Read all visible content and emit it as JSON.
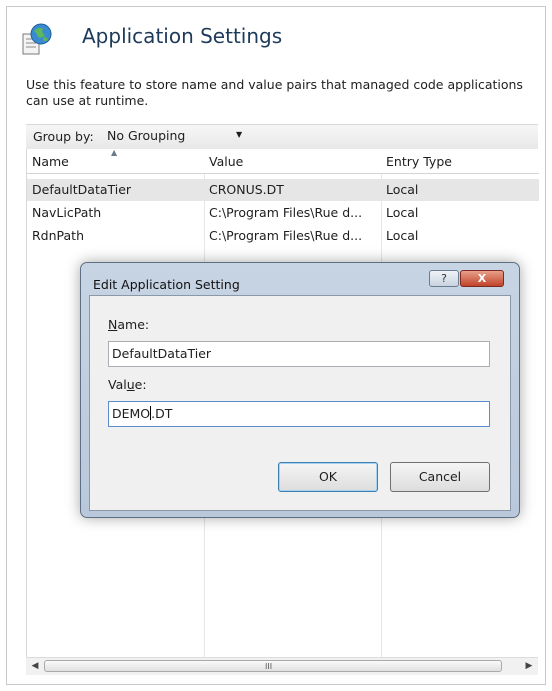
{
  "page": {
    "title": "Application Settings",
    "description": "Use this feature to store name and value pairs that managed code applications can use at runtime.",
    "icon": "globe-document-icon"
  },
  "toolbar": {
    "groupby_label": "Group by:",
    "groupby_value": "No Grouping"
  },
  "grid": {
    "columns": [
      "Name",
      "Value",
      "Entry Type"
    ],
    "rows": [
      {
        "name": "DefaultDataTier",
        "value": "CRONUS.DT",
        "entry_type": "Local",
        "selected": true
      },
      {
        "name": "NavLicPath",
        "value": "C:\\Program Files\\Rue d...",
        "entry_type": "Local",
        "selected": false
      },
      {
        "name": "RdnPath",
        "value": "C:\\Program Files\\Rue d...",
        "entry_type": "Local",
        "selected": false
      }
    ]
  },
  "scrollbar": {
    "grip": "III"
  },
  "dialog": {
    "title": "Edit Application Setting",
    "help_label": "?",
    "close_label": "X",
    "name_label_pre": "",
    "name_label_underline": "N",
    "name_label_post": "ame:",
    "name_value": "DefaultDataTier",
    "value_label_pre": "Val",
    "value_label_underline": "u",
    "value_label_post": "e:",
    "value_before_caret": "DEMO",
    "value_after_caret": ".DT",
    "ok_label": "OK",
    "cancel_label": "Cancel"
  },
  "colors": {
    "title_text": "#1e3a5a",
    "selected_row": "#e6e6e6",
    "dialog_frame": "#c7d4e3",
    "close_button": "#c0432a"
  }
}
